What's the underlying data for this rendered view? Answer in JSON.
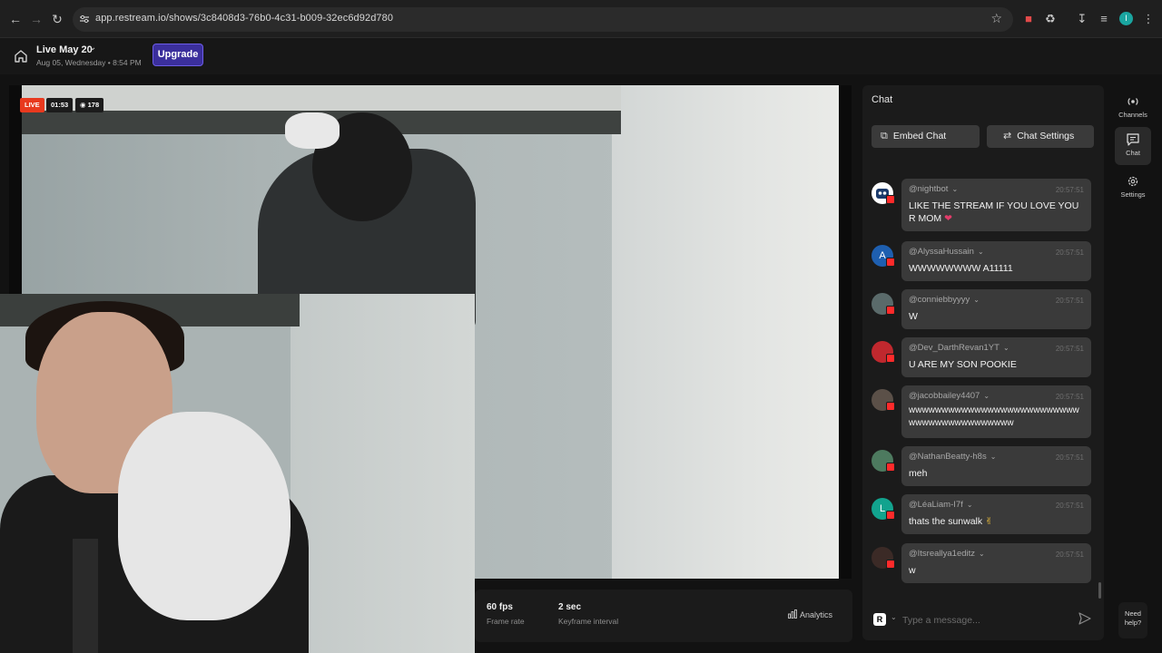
{
  "browser": {
    "url": "app.restream.io/shows/3c8408d3-76b0-4c31-b009-32ec6d92d780",
    "profile_initial": "I"
  },
  "header": {
    "show_title": "Live May 20",
    "show_date": "Aug 05, Wednesday • 8:54 PM",
    "upgrade_label": "Upgrade"
  },
  "stage": {
    "live_label": "LIVE",
    "elapsed": "01:53",
    "viewers": "178"
  },
  "stats": {
    "frame_rate_value": "60 fps",
    "frame_rate_label": "Frame rate",
    "keyframe_value": "2 sec",
    "keyframe_label": "Keyframe interval",
    "analytics_label": "Analytics"
  },
  "chat": {
    "title": "Chat",
    "embed_label": "Embed Chat",
    "settings_label": "Chat Settings",
    "input_placeholder": "Type a message...",
    "messages": [
      {
        "user": "@nightbot",
        "time": "20:57:51",
        "text": "LIKE THE STREAM IF YOU LOVE YOUR MOM",
        "avatar": "",
        "avatar_color": "#ffffff"
      },
      {
        "user": "@AlyssaHussain",
        "time": "20:57:51",
        "text": "WWWWWWWW A11111",
        "avatar": "A",
        "avatar_color": "#1e5fb0"
      },
      {
        "user": "@conniebbyyyy",
        "time": "20:57:51",
        "text": "W",
        "avatar": "",
        "avatar_color": "#5a6a6a"
      },
      {
        "user": "@Dev_DarthRevan1YT",
        "time": "20:57:51",
        "text": "U ARE MY SON POOKIE",
        "avatar": "",
        "avatar_color": "#c0282e"
      },
      {
        "user": "@jacobbailey4407",
        "time": "20:57:51",
        "text": "wwwwwwwwwwwwwwwwwwwwwwwwwwwwwwwwwwwwwwwwww",
        "avatar": "",
        "avatar_color": "#5b5048"
      },
      {
        "user": "@NathanBeatty-h8s",
        "time": "20:57:51",
        "text": "meh",
        "avatar": "",
        "avatar_color": "#4d7a5f"
      },
      {
        "user": "@LéaLiam-I7f",
        "time": "20:57:51",
        "text": "thats the sunwalk",
        "avatar": "L",
        "avatar_color": "#12a38e"
      },
      {
        "user": "@Itsreallya1editz",
        "time": "20:57:51",
        "text": "w",
        "avatar": "",
        "avatar_color": "#3b2a26"
      }
    ]
  },
  "rail": {
    "channels_label": "Channels",
    "chat_label": "Chat",
    "settings_label": "Settings",
    "help_label_1": "Need",
    "help_label_2": "help?"
  },
  "colors": {
    "live_red": "#e8391e",
    "upgrade_purple": "#3b2f9c",
    "youtube_red": "#ff2a2a"
  }
}
